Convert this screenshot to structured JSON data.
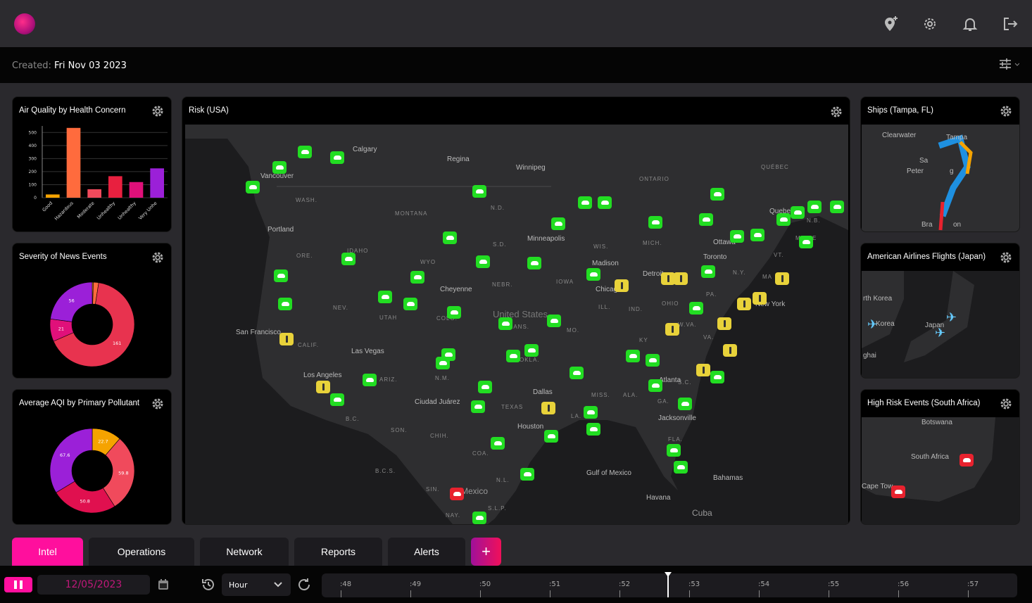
{
  "header": {
    "logo": "app-logo",
    "icons": [
      "add-location-icon",
      "gear-icon",
      "bell-icon",
      "logout-icon"
    ]
  },
  "subheader": {
    "created_label": "Created:",
    "created_value": "Fri Nov 03 2023",
    "filter_icon": "sliders-icon"
  },
  "panels": {
    "air_quality": {
      "title": "Air Quality by Health Concern"
    },
    "news": {
      "title": "Severity of News Events"
    },
    "aqi": {
      "title": "Average AQI by Primary Pollutant"
    },
    "risk": {
      "title": "Risk (USA)"
    },
    "ships": {
      "title": "Ships (Tampa, FL)",
      "labels": [
        "Clearwater",
        "Tampa",
        "Sa",
        "Peter",
        "g",
        "Bra",
        "on"
      ]
    },
    "flights": {
      "title": "American Airlines Flights (Japan)",
      "labels": [
        "rth Korea",
        "Korea",
        "Japan",
        "ghai"
      ]
    },
    "south_africa": {
      "title": "High Risk Events (South Africa)",
      "labels": [
        "Botswana",
        "South Africa",
        "Cape Tow"
      ]
    }
  },
  "chart_data": [
    {
      "type": "bar",
      "title": "Air Quality by Health Concern",
      "categories": [
        "Good",
        "Hazardous",
        "Moderate",
        "Unhealthy",
        "Unhealthy",
        "Very Unhe"
      ],
      "values": [
        25,
        535,
        65,
        165,
        120,
        225
      ],
      "colors": [
        "#f5a300",
        "#ff6b3d",
        "#f04a5c",
        "#e8203f",
        "#e0107a",
        "#9b20d8"
      ],
      "ylim": [
        0,
        550
      ],
      "yticks": [
        0,
        100,
        200,
        300,
        400,
        500
      ],
      "grid": true
    },
    {
      "type": "pie",
      "title": "Severity of News Events",
      "donut": true,
      "values": [
        1,
        5,
        161,
        21,
        56
      ],
      "labels": [
        "",
        "",
        "161",
        "21",
        "56"
      ],
      "colors": [
        "#f5a300",
        "#ff6b3d",
        "#e8334f",
        "#e0107a",
        "#9b20d8"
      ]
    },
    {
      "type": "pie",
      "title": "Average AQI by Primary Pollutant",
      "donut": true,
      "values": [
        22.7,
        59.8,
        50.8,
        67.6
      ],
      "labels": [
        "22.7",
        "59.8",
        "50.8",
        "67.6"
      ],
      "colors": [
        "#f5a300",
        "#f04a5c",
        "#e0104f",
        "#9b20d8"
      ]
    }
  ],
  "map": {
    "labels": [
      "Calgary",
      "Regina",
      "Winnipeg",
      "Vancouver",
      "ONTARIO",
      "QUÉBEC",
      "WASH.",
      "MONTANA",
      "N.D.",
      "Portland",
      "Minneapolis",
      "Ottawa",
      "Quebec",
      "ORE.",
      "IDAHO",
      "WYO",
      "S.D.",
      "WIS.",
      "MICH.",
      "Toronto",
      "Madison",
      "Detroit",
      "Cheyenne",
      "NEBR.",
      "IOWA",
      "Chicago",
      "N.Y.",
      "NEV.",
      "UTAH",
      "COLO.",
      "United States",
      "ILL.",
      "IND.",
      "OHIO",
      "PA.",
      "New York",
      "San Francisco",
      "KANS.",
      "MO.",
      "W.VA.",
      "VA.",
      "CALIF.",
      "Las Vegas",
      "KY",
      "Los Angeles",
      "ARIZ.",
      "N.M.",
      "OKLA.",
      "Atlanta",
      "Dallas",
      "MISS.",
      "ALA.",
      "S.C.",
      "Ciudad Juárez",
      "TEXAS",
      "GA.",
      "B.C.",
      "LA.",
      "Jacksonville",
      "Houston",
      "SON.",
      "CHIH.",
      "COA.",
      "FLA.",
      "Gulf of Mexico",
      "B.C.S.",
      "Bahamas",
      "N.L.",
      "SIN.",
      "Mexico",
      "Havana",
      "S.L.P.",
      "Cuba",
      "NAY.",
      "MAINE",
      "VT.",
      "N.B.",
      "MA"
    ],
    "marker_legend": {
      "green": "weather",
      "yellow": "alert",
      "red": "severe-weather"
    }
  },
  "tabs": [
    {
      "label": "Intel",
      "active": true
    },
    {
      "label": "Operations"
    },
    {
      "label": "Network"
    },
    {
      "label": "Reports"
    },
    {
      "label": "Alerts"
    },
    {
      "label": "+"
    }
  ],
  "controls": {
    "date": "12/05/2023",
    "interval": "Hour",
    "timeline_ticks": [
      ":48",
      ":49",
      ":50",
      ":51",
      ":52",
      ":53",
      ":54",
      ":55",
      ":56",
      ":57"
    ],
    "cursor_minute": 52.7
  },
  "colors": {
    "accent": "#ff0f9d",
    "marker_green": "#22dd22",
    "marker_yellow": "#e8d23a",
    "marker_red": "#e8222e"
  }
}
